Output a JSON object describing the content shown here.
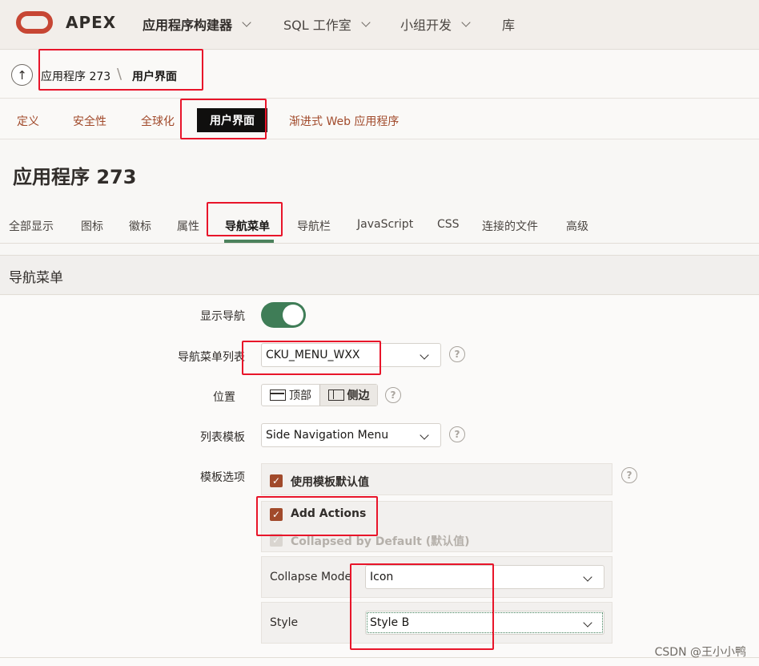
{
  "header": {
    "logo_text": "APEX",
    "nav": [
      {
        "label": "应用程序构建器",
        "has_menu": true
      },
      {
        "label": "SQL 工作室",
        "has_menu": true
      },
      {
        "label": "小组开发",
        "has_menu": true
      },
      {
        "label": "库",
        "has_menu": false
      }
    ]
  },
  "breadcrumb": {
    "items": [
      "应用程序 273",
      "用户界面"
    ],
    "separator": "\\"
  },
  "top_tabs": [
    "定义",
    "安全性",
    "全球化",
    "用户界面",
    "渐进式 Web 应用程序"
  ],
  "active_top_tab": "用户界面",
  "page_title": "应用程序 273",
  "sub_tabs": [
    "全部显示",
    "图标",
    "徽标",
    "属性",
    "导航菜单",
    "导航栏",
    "JavaScript",
    "CSS",
    "连接的文件",
    "高级"
  ],
  "active_sub_tab": "导航菜单",
  "region": {
    "title": "导航菜单",
    "fields": {
      "show_nav": {
        "label": "显示导航",
        "value": true
      },
      "menu_list": {
        "label": "导航菜单列表",
        "value": "CKU_MENU_WXX",
        "help": "?"
      },
      "position": {
        "label": "位置",
        "options": [
          "顶部",
          "侧边"
        ],
        "selected": "侧边",
        "help": "?"
      },
      "list_template": {
        "label": "列表模板",
        "value": "Side Navigation Menu",
        "help": "?"
      },
      "template_options": {
        "label": "模板选项",
        "help": "?",
        "checkboxes": [
          {
            "label": "使用模板默认值",
            "checked": true,
            "disabled": false
          },
          {
            "label": "Add Actions",
            "checked": true,
            "disabled": false
          },
          {
            "label": "Collapsed by Default (默认值)",
            "checked": true,
            "disabled": true
          }
        ],
        "collapse_mode": {
          "label": "Collapse Mode",
          "value": "Icon"
        },
        "style": {
          "label": "Style",
          "value": "Style B"
        }
      }
    }
  },
  "watermark": "CSDN @王小小鸭",
  "colors": {
    "accent": "#a14a2b",
    "toggle_on": "#3f7d57",
    "oracle_red": "#c74634",
    "annotation": "#e8152a"
  }
}
